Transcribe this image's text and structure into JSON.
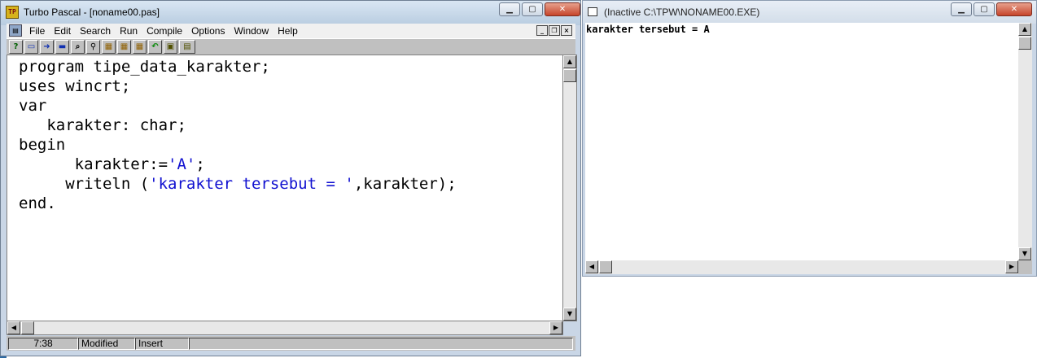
{
  "editor_window": {
    "title": "Turbo Pascal - [noname00.pas]",
    "app_icon_text": "TP",
    "menu": [
      "File",
      "Edit",
      "Search",
      "Run",
      "Compile",
      "Options",
      "Window",
      "Help"
    ],
    "toolbar_icons": [
      "help-icon",
      "open-file-icon",
      "save-file-icon",
      "search-icon",
      "find-icon",
      "compile-icon",
      "make-icon",
      "run-icon",
      "undo-icon",
      "clipboard-icon",
      "tp-icon"
    ],
    "code": {
      "line1": "program tipe_data_karakter;",
      "line2": "uses wincrt;",
      "line3": "var",
      "line4": "   karakter: char;",
      "line5": "begin",
      "line6_a": "      karakter:=",
      "line6_str": "'A'",
      "line6_b": ";",
      "line7_a": "     writeln (",
      "line7_str": "'karakter tersebut = '",
      "line7_b": ",karakter);",
      "line8": "end."
    },
    "status": {
      "position": "7:38",
      "modified": "Modified",
      "mode": "Insert"
    }
  },
  "output_window": {
    "title": "(Inactive C:\\TPW\\NONAME00.EXE)",
    "output_text": "karakter tersebut = A"
  },
  "colors": {
    "string_literal": "#1010d0",
    "close_button": "#c6452b"
  }
}
